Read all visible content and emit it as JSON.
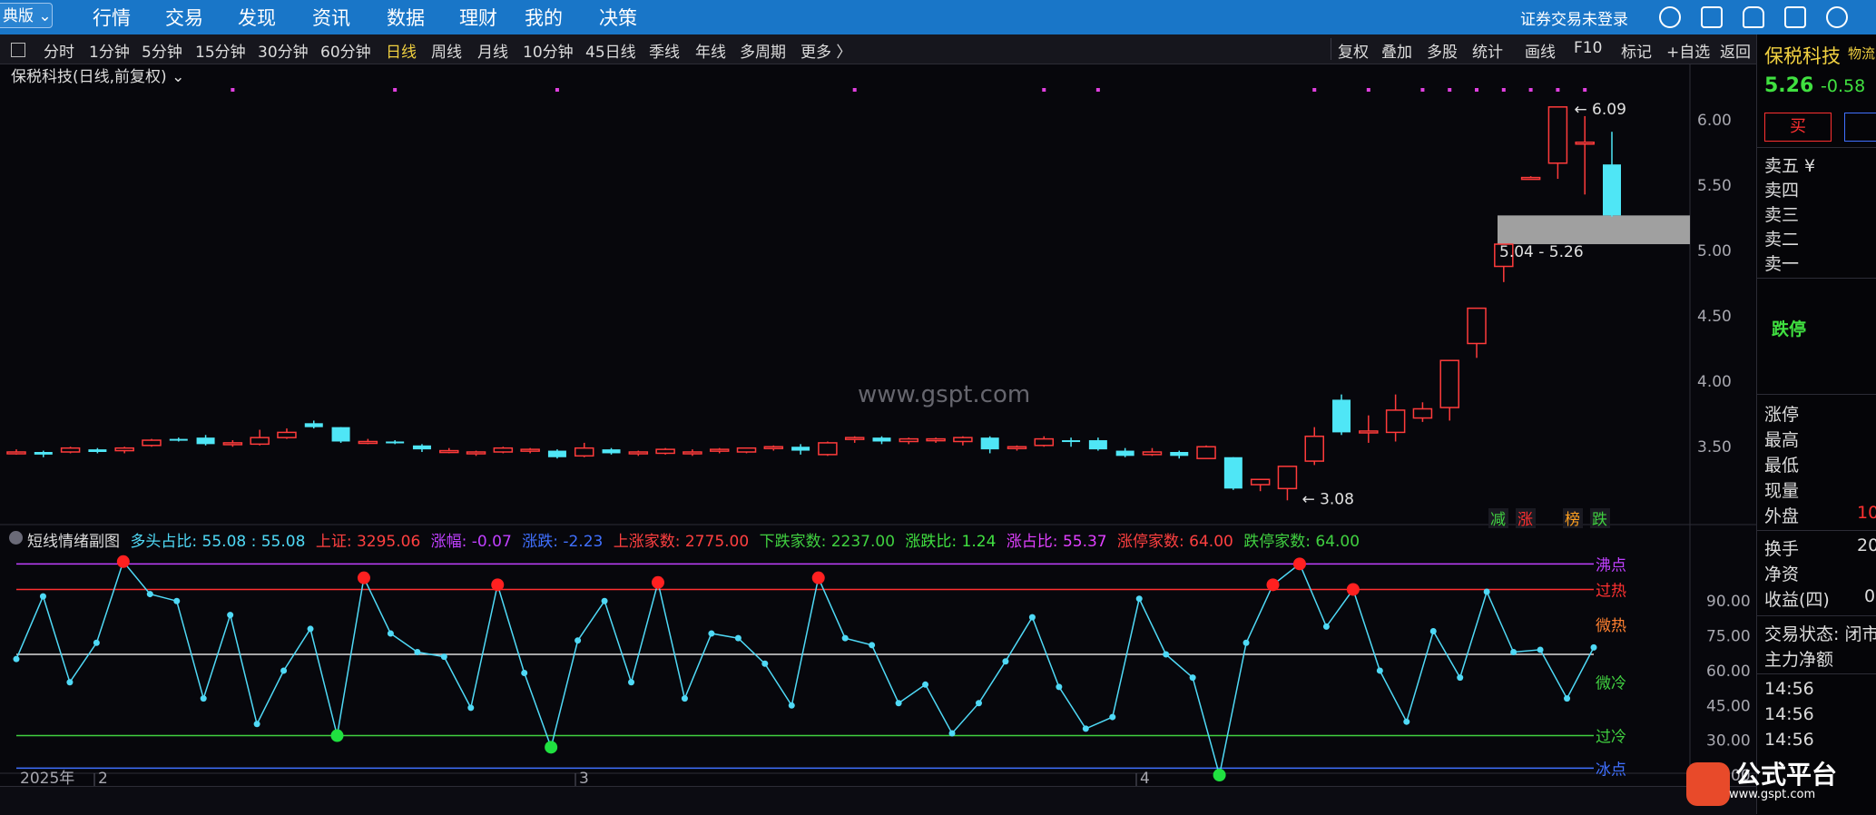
{
  "topnav": {
    "edition": "典版",
    "items": [
      "行情",
      "交易",
      "发现",
      "资讯",
      "数据",
      "理财",
      "我的",
      "决策"
    ],
    "login": "证券交易未登录"
  },
  "periods": [
    "分时",
    "1分钟",
    "5分钟",
    "15分钟",
    "30分钟",
    "60分钟",
    "日线",
    "周线",
    "月线",
    "10分钟",
    "45日线",
    "季线",
    "年线",
    "多周期",
    "更多 〉"
  ],
  "active_period": "日线",
  "right_tools": [
    "复权",
    "叠加",
    "多股",
    "统计",
    "画线",
    "F10",
    "标记",
    "+自选",
    "返回"
  ],
  "main_chart": {
    "title": "保税科技(日线,前复权)",
    "y_ticks": [
      "6.00",
      "5.50",
      "5.00",
      "4.50",
      "4.00",
      "3.50"
    ],
    "high_label": "6.09",
    "low_label": "3.08",
    "range_label": "5.04 - 5.26",
    "markers": [
      {
        "text": "减",
        "color": "#40d040"
      },
      {
        "text": "涨",
        "color": "#ff3030"
      },
      {
        "text": "榜",
        "color": "#ffa020"
      },
      {
        "text": "跌",
        "color": "#40d040"
      }
    ]
  },
  "sub_chart": {
    "title": "短线情绪副图",
    "fields": [
      {
        "label": "多头占比: 55.08 : 55.08",
        "color": "#4fd9f6"
      },
      {
        "label": "上证: 3295.06",
        "color": "#ff4040"
      },
      {
        "label": "涨幅: -0.07",
        "color": "#c040ff"
      },
      {
        "label": "涨跌: -2.23",
        "color": "#4070ff"
      },
      {
        "label": "上涨家数: 2775.00",
        "color": "#ff4040"
      },
      {
        "label": "下跌家数: 2237.00",
        "color": "#40d040"
      },
      {
        "label": "涨跌比: 1.24",
        "color": "#40e040"
      },
      {
        "label": "涨占比: 55.37",
        "color": "#e040ff"
      },
      {
        "label": "涨停家数: 64.00",
        "color": "#ff4040"
      },
      {
        "label": "跌停家数: 64.00",
        "color": "#40d040"
      }
    ],
    "y_ticks": [
      "90.00",
      "75.00",
      "60.00",
      "45.00",
      "30.00",
      "15.00"
    ],
    "levels": [
      {
        "name": "沸点",
        "color": "#c040ff"
      },
      {
        "name": "过热",
        "color": "#ff3030"
      },
      {
        "name": "微热",
        "color": "#ff8030"
      },
      {
        "name": "微冷",
        "color": "#40d040"
      },
      {
        "name": "过冷",
        "color": "#40d040"
      },
      {
        "name": "冰点",
        "color": "#4070ff"
      }
    ]
  },
  "x_axis": [
    "2025年",
    "2",
    "3",
    "4"
  ],
  "chart_data": {
    "type": "line",
    "series": [
      {
        "name": "多头占比",
        "values": [
          50,
          77,
          40,
          57,
          92,
          78,
          75,
          33,
          69,
          22,
          45,
          63,
          17,
          85,
          61,
          53,
          51,
          29,
          82,
          44,
          12,
          58,
          75,
          40,
          83,
          33,
          61,
          59,
          48,
          30,
          85,
          59,
          56,
          31,
          39,
          18,
          31,
          49,
          68,
          38,
          20,
          25,
          76,
          52,
          42,
          0,
          57,
          82,
          91,
          64,
          80,
          45,
          23,
          62,
          42,
          79,
          53,
          54,
          33,
          55
        ]
      }
    ],
    "ylim": [
      0,
      97
    ],
    "price_candles": {
      "ohlc": [
        [
          3.44,
          3.47,
          3.43,
          3.45
        ],
        [
          3.45,
          3.46,
          3.41,
          3.43
        ],
        [
          3.45,
          3.49,
          3.44,
          3.48
        ],
        [
          3.47,
          3.48,
          3.44,
          3.45
        ],
        [
          3.46,
          3.49,
          3.44,
          3.48
        ],
        [
          3.5,
          3.55,
          3.49,
          3.54
        ],
        [
          3.55,
          3.56,
          3.53,
          3.54
        ],
        [
          3.56,
          3.58,
          3.5,
          3.51
        ],
        [
          3.52,
          3.54,
          3.49,
          3.52
        ],
        [
          3.51,
          3.62,
          3.5,
          3.56
        ],
        [
          3.56,
          3.63,
          3.55,
          3.6
        ],
        [
          3.67,
          3.69,
          3.63,
          3.64
        ],
        [
          3.64,
          3.64,
          3.52,
          3.53
        ],
        [
          3.53,
          3.55,
          3.51,
          3.53
        ],
        [
          3.53,
          3.54,
          3.51,
          3.52
        ],
        [
          3.5,
          3.51,
          3.45,
          3.47
        ],
        [
          3.46,
          3.48,
          3.44,
          3.46
        ],
        [
          3.45,
          3.46,
          3.42,
          3.45
        ],
        [
          3.45,
          3.49,
          3.44,
          3.48
        ],
        [
          3.47,
          3.48,
          3.44,
          3.47
        ],
        [
          3.46,
          3.47,
          3.4,
          3.41
        ],
        [
          3.42,
          3.52,
          3.41,
          3.48
        ],
        [
          3.47,
          3.48,
          3.43,
          3.44
        ],
        [
          3.44,
          3.46,
          3.42,
          3.45
        ],
        [
          3.44,
          3.48,
          3.43,
          3.47
        ],
        [
          3.45,
          3.47,
          3.42,
          3.45
        ],
        [
          3.46,
          3.48,
          3.44,
          3.47
        ],
        [
          3.45,
          3.48,
          3.44,
          3.48
        ],
        [
          3.48,
          3.5,
          3.46,
          3.49
        ],
        [
          3.49,
          3.51,
          3.43,
          3.46
        ],
        [
          3.43,
          3.53,
          3.42,
          3.52
        ],
        [
          3.55,
          3.57,
          3.52,
          3.56
        ],
        [
          3.56,
          3.57,
          3.51,
          3.53
        ],
        [
          3.53,
          3.56,
          3.51,
          3.55
        ],
        [
          3.55,
          3.56,
          3.52,
          3.55
        ],
        [
          3.53,
          3.57,
          3.5,
          3.56
        ],
        [
          3.56,
          3.57,
          3.44,
          3.47
        ],
        [
          3.48,
          3.5,
          3.46,
          3.49
        ],
        [
          3.5,
          3.57,
          3.49,
          3.55
        ],
        [
          3.54,
          3.56,
          3.49,
          3.53
        ],
        [
          3.54,
          3.56,
          3.46,
          3.47
        ],
        [
          3.46,
          3.48,
          3.41,
          3.42
        ],
        [
          3.43,
          3.48,
          3.42,
          3.45
        ],
        [
          3.45,
          3.46,
          3.4,
          3.42
        ],
        [
          3.4,
          3.5,
          3.4,
          3.49
        ],
        [
          3.41,
          3.41,
          3.16,
          3.17
        ],
        [
          3.2,
          3.22,
          3.15,
          3.24
        ],
        [
          3.17,
          3.26,
          3.08,
          3.34
        ],
        [
          3.38,
          3.64,
          3.35,
          3.57
        ],
        [
          3.85,
          3.89,
          3.58,
          3.6
        ],
        [
          3.6,
          3.73,
          3.52,
          3.61
        ],
        [
          3.6,
          3.89,
          3.53,
          3.77
        ],
        [
          3.71,
          3.83,
          3.68,
          3.78
        ],
        [
          3.79,
          3.93,
          3.69,
          4.15
        ],
        [
          4.28,
          4.55,
          4.17,
          4.55
        ],
        [
          4.87,
          5.04,
          4.75,
          5.04
        ],
        [
          5.55,
          5.56,
          5.54,
          5.55
        ],
        [
          5.66,
          6.09,
          5.54,
          6.09
        ],
        [
          5.82,
          6.02,
          5.42,
          5.82
        ],
        [
          5.65,
          5.9,
          5.25,
          5.26
        ]
      ],
      "ylim": [
        2.95,
        6.2
      ]
    }
  },
  "right_panel": {
    "stock_name": "保税科技",
    "sector": "物流",
    "price": "5.26",
    "change": "-0.58",
    "buy": "买",
    "sell_levels": [
      "卖五 ¥",
      "卖四",
      "卖三",
      "卖二",
      "卖一"
    ],
    "limit_down": "跌停",
    "stats": [
      "涨停",
      "最高",
      "最低",
      "现量",
      "外盘"
    ],
    "outer_value": "10",
    "more": [
      "换手",
      "净资",
      "收益(四)"
    ],
    "turnover_value": "20",
    "eps_value": "0",
    "trade_status_label": "交易状态: 闭市",
    "fund_flow_label": "主力净额",
    "times": [
      "14:56",
      "14:56",
      "14:56"
    ]
  },
  "watermark": "www.gspt.com",
  "logo": {
    "text": "公式平台",
    "url": "www.gspt.com"
  }
}
